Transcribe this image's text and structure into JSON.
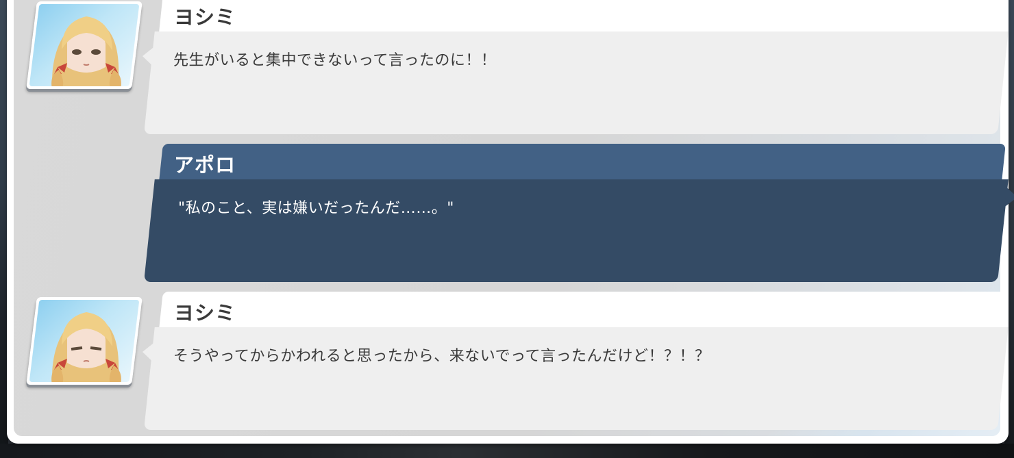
{
  "dialogue_log": {
    "entries": [
      {
        "speaker": "ヨシミ",
        "text": "先生がいると集中できないって言ったのに！！",
        "is_player": false
      },
      {
        "speaker": "アポロ",
        "text": "\"私のこと、実は嫌いだったんだ……。\"",
        "is_player": true
      },
      {
        "speaker": "ヨシミ",
        "text": "そうやってからかわれると思ったから、来ないでって言ったんだけど！？！？",
        "is_player": false
      }
    ]
  },
  "colors": {
    "npc_name_bar": "#ffffff",
    "npc_message": "#efefef",
    "player_name_bar": "#426185",
    "player_message": "#344b65",
    "panel_bg": "#d9d9d9"
  }
}
